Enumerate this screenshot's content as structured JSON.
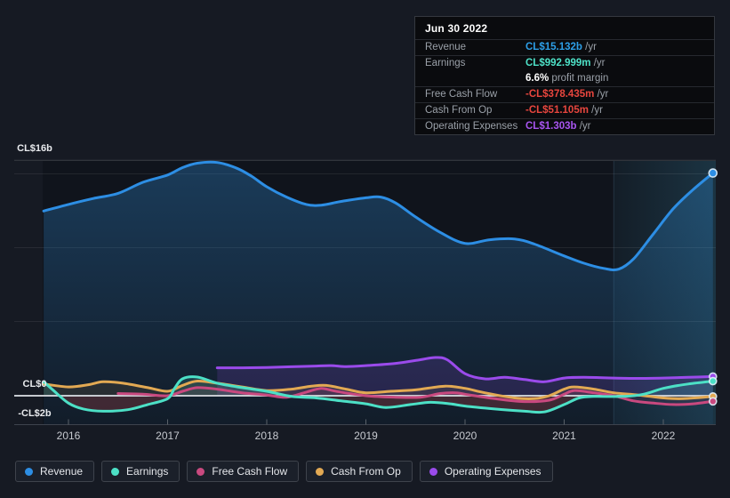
{
  "tooltip": {
    "date": "Jun 30 2022",
    "rows": [
      {
        "label": "Revenue",
        "value": "CL$15.132b",
        "unit": "/yr",
        "color": "#2d9fe8"
      },
      {
        "label": "Earnings",
        "value": "CL$992.999m",
        "unit": "/yr",
        "color": "#4ee2c8"
      },
      {
        "label": "Free Cash Flow",
        "value": "-CL$378.435m",
        "unit": "/yr",
        "color": "#e8463e"
      },
      {
        "label": "Cash From Op",
        "value": "-CL$51.105m",
        "unit": "/yr",
        "color": "#e8463e"
      },
      {
        "label": "Operating Expenses",
        "value": "CL$1.303b",
        "unit": "/yr",
        "color": "#a855f0"
      }
    ],
    "profit_margin": {
      "value": "6.6%",
      "label": "profit margin"
    }
  },
  "legend": {
    "items": [
      "Revenue",
      "Earnings",
      "Free Cash Flow",
      "Cash From Op",
      "Operating Expenses"
    ]
  },
  "chart_data": {
    "type": "line",
    "title": "",
    "unit": "CL$ billions per year",
    "x_axis": {
      "ticks": [
        2016,
        2017,
        2018,
        2019,
        2020,
        2021,
        2022
      ],
      "tick_labels": [
        "2016",
        "2017",
        "2018",
        "2019",
        "2020",
        "2021",
        "2022"
      ],
      "range": [
        2015.75,
        2022.53
      ]
    },
    "y_axis": {
      "unit": "CL$b",
      "range": [
        -2,
        16
      ],
      "labels": [
        {
          "text": "CL$16b",
          "value": 16
        },
        {
          "text": "CL$0",
          "value": 0
        },
        {
          "text": "-CL$2b",
          "value": -2
        }
      ]
    },
    "highlight_band": {
      "from_year": 2021.5,
      "to_year": 2022.53
    },
    "series": [
      {
        "name": "Revenue",
        "color": "#2d8ee4",
        "points": [
          [
            2015.75,
            12.55
          ],
          [
            2016,
            13.0
          ],
          [
            2016.25,
            13.4
          ],
          [
            2016.5,
            13.75
          ],
          [
            2016.75,
            14.5
          ],
          [
            2017,
            15.0
          ],
          [
            2017.15,
            15.5
          ],
          [
            2017.3,
            15.8
          ],
          [
            2017.5,
            15.85
          ],
          [
            2017.7,
            15.45
          ],
          [
            2017.85,
            14.9
          ],
          [
            2018,
            14.2
          ],
          [
            2018.2,
            13.5
          ],
          [
            2018.4,
            13.0
          ],
          [
            2018.55,
            12.95
          ],
          [
            2018.75,
            13.2
          ],
          [
            2019,
            13.45
          ],
          [
            2019.15,
            13.5
          ],
          [
            2019.3,
            13.1
          ],
          [
            2019.5,
            12.15
          ],
          [
            2019.75,
            11.1
          ],
          [
            2020,
            10.35
          ],
          [
            2020.25,
            10.6
          ],
          [
            2020.5,
            10.65
          ],
          [
            2020.7,
            10.3
          ],
          [
            2021,
            9.5
          ],
          [
            2021.2,
            9.0
          ],
          [
            2021.4,
            8.65
          ],
          [
            2021.55,
            8.6
          ],
          [
            2021.7,
            9.3
          ],
          [
            2021.9,
            11.0
          ],
          [
            2022.1,
            12.7
          ],
          [
            2022.3,
            14.0
          ],
          [
            2022.5,
            15.132
          ]
        ]
      },
      {
        "name": "Earnings",
        "color": "#4ce0c6",
        "points": [
          [
            2015.75,
            0.95
          ],
          [
            2015.85,
            0.35
          ],
          [
            2016,
            -0.5
          ],
          [
            2016.15,
            -0.9
          ],
          [
            2016.35,
            -1.05
          ],
          [
            2016.6,
            -0.95
          ],
          [
            2016.8,
            -0.6
          ],
          [
            2017,
            -0.2
          ],
          [
            2017.07,
            0.5
          ],
          [
            2017.15,
            1.15
          ],
          [
            2017.3,
            1.27
          ],
          [
            2017.5,
            0.85
          ],
          [
            2017.75,
            0.55
          ],
          [
            2018,
            0.3
          ],
          [
            2018.25,
            -0.05
          ],
          [
            2018.5,
            -0.15
          ],
          [
            2018.75,
            -0.35
          ],
          [
            2019,
            -0.55
          ],
          [
            2019.2,
            -0.8
          ],
          [
            2019.45,
            -0.6
          ],
          [
            2019.65,
            -0.45
          ],
          [
            2019.85,
            -0.55
          ],
          [
            2020,
            -0.7
          ],
          [
            2020.3,
            -0.9
          ],
          [
            2020.6,
            -1.05
          ],
          [
            2020.8,
            -1.1
          ],
          [
            2021,
            -0.6
          ],
          [
            2021.15,
            -0.15
          ],
          [
            2021.3,
            -0.05
          ],
          [
            2021.6,
            -0.05
          ],
          [
            2021.8,
            0.1
          ],
          [
            2022,
            0.5
          ],
          [
            2022.25,
            0.8
          ],
          [
            2022.5,
            0.993
          ]
        ]
      },
      {
        "name": "Free Cash Flow",
        "color": "#c9497f",
        "points": [
          [
            2016.5,
            0.15
          ],
          [
            2016.75,
            0.1
          ],
          [
            2017,
            0.0
          ],
          [
            2017.15,
            0.3
          ],
          [
            2017.3,
            0.55
          ],
          [
            2017.5,
            0.45
          ],
          [
            2017.75,
            0.2
          ],
          [
            2018,
            0.05
          ],
          [
            2018.2,
            -0.1
          ],
          [
            2018.4,
            0.25
          ],
          [
            2018.55,
            0.5
          ],
          [
            2018.7,
            0.3
          ],
          [
            2019,
            0.0
          ],
          [
            2019.3,
            -0.1
          ],
          [
            2019.55,
            -0.1
          ],
          [
            2019.75,
            0.15
          ],
          [
            2019.9,
            0.2
          ],
          [
            2020,
            0.1
          ],
          [
            2020.3,
            -0.2
          ],
          [
            2020.6,
            -0.4
          ],
          [
            2020.85,
            -0.3
          ],
          [
            2021,
            0.1
          ],
          [
            2021.1,
            0.35
          ],
          [
            2021.3,
            0.2
          ],
          [
            2021.5,
            0.0
          ],
          [
            2021.7,
            -0.35
          ],
          [
            2021.9,
            -0.5
          ],
          [
            2022.1,
            -0.6
          ],
          [
            2022.3,
            -0.55
          ],
          [
            2022.5,
            -0.378
          ]
        ]
      },
      {
        "name": "Cash From Op",
        "color": "#e2a953",
        "points": [
          [
            2015.75,
            0.8
          ],
          [
            2016,
            0.6
          ],
          [
            2016.2,
            0.75
          ],
          [
            2016.35,
            0.95
          ],
          [
            2016.55,
            0.85
          ],
          [
            2016.8,
            0.55
          ],
          [
            2017,
            0.3
          ],
          [
            2017.15,
            0.7
          ],
          [
            2017.3,
            1.0
          ],
          [
            2017.5,
            0.85
          ],
          [
            2017.75,
            0.6
          ],
          [
            2018,
            0.35
          ],
          [
            2018.25,
            0.45
          ],
          [
            2018.45,
            0.65
          ],
          [
            2018.6,
            0.7
          ],
          [
            2018.8,
            0.45
          ],
          [
            2019,
            0.2
          ],
          [
            2019.25,
            0.3
          ],
          [
            2019.5,
            0.4
          ],
          [
            2019.8,
            0.65
          ],
          [
            2020,
            0.5
          ],
          [
            2020.2,
            0.2
          ],
          [
            2020.5,
            -0.15
          ],
          [
            2020.7,
            -0.2
          ],
          [
            2020.85,
            0.0
          ],
          [
            2021,
            0.45
          ],
          [
            2021.1,
            0.6
          ],
          [
            2021.3,
            0.45
          ],
          [
            2021.5,
            0.2
          ],
          [
            2021.75,
            0.05
          ],
          [
            2022,
            -0.15
          ],
          [
            2022.2,
            -0.2
          ],
          [
            2022.5,
            -0.051
          ]
        ]
      },
      {
        "name": "Operating Expenses",
        "color": "#9a4beb",
        "points": [
          [
            2017.5,
            1.9
          ],
          [
            2017.75,
            1.9
          ],
          [
            2018,
            1.92
          ],
          [
            2018.25,
            1.97
          ],
          [
            2018.5,
            2.02
          ],
          [
            2018.65,
            2.05
          ],
          [
            2018.8,
            1.98
          ],
          [
            2019,
            2.05
          ],
          [
            2019.3,
            2.2
          ],
          [
            2019.55,
            2.45
          ],
          [
            2019.7,
            2.6
          ],
          [
            2019.82,
            2.45
          ],
          [
            2020,
            1.5
          ],
          [
            2020.2,
            1.15
          ],
          [
            2020.4,
            1.25
          ],
          [
            2020.6,
            1.1
          ],
          [
            2020.8,
            0.95
          ],
          [
            2021,
            1.2
          ],
          [
            2021.2,
            1.25
          ],
          [
            2021.5,
            1.2
          ],
          [
            2021.75,
            1.18
          ],
          [
            2022,
            1.2
          ],
          [
            2022.25,
            1.25
          ],
          [
            2022.5,
            1.303
          ]
        ]
      }
    ]
  }
}
